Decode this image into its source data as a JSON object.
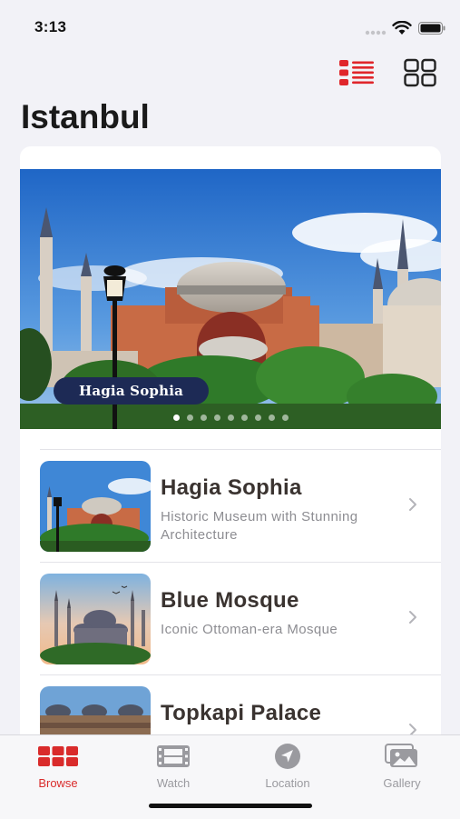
{
  "status_bar": {
    "time": "3:13"
  },
  "toolbar": {
    "list_view_icon": "list-view-icon",
    "grid_view_icon": "grid-view-icon",
    "accent": "#e0262b"
  },
  "page": {
    "title": "Istanbul"
  },
  "hero": {
    "caption": "Hagia Sophia",
    "page_count": 9,
    "current_page": 0
  },
  "places": [
    {
      "name": "Hagia Sophia",
      "description": "Historic Museum with Stunning Architecture"
    },
    {
      "name": "Blue Mosque",
      "description": "Iconic Ottoman-era Mosque"
    },
    {
      "name": "Topkapi Palace",
      "description": ""
    }
  ],
  "tabbar": {
    "active_color": "#d92b2b",
    "items": [
      {
        "label": "Browse",
        "icon": "grid-icon"
      },
      {
        "label": "Watch",
        "icon": "film-icon"
      },
      {
        "label": "Location",
        "icon": "location-arrow-icon"
      },
      {
        "label": "Gallery",
        "icon": "photos-icon"
      }
    ]
  }
}
